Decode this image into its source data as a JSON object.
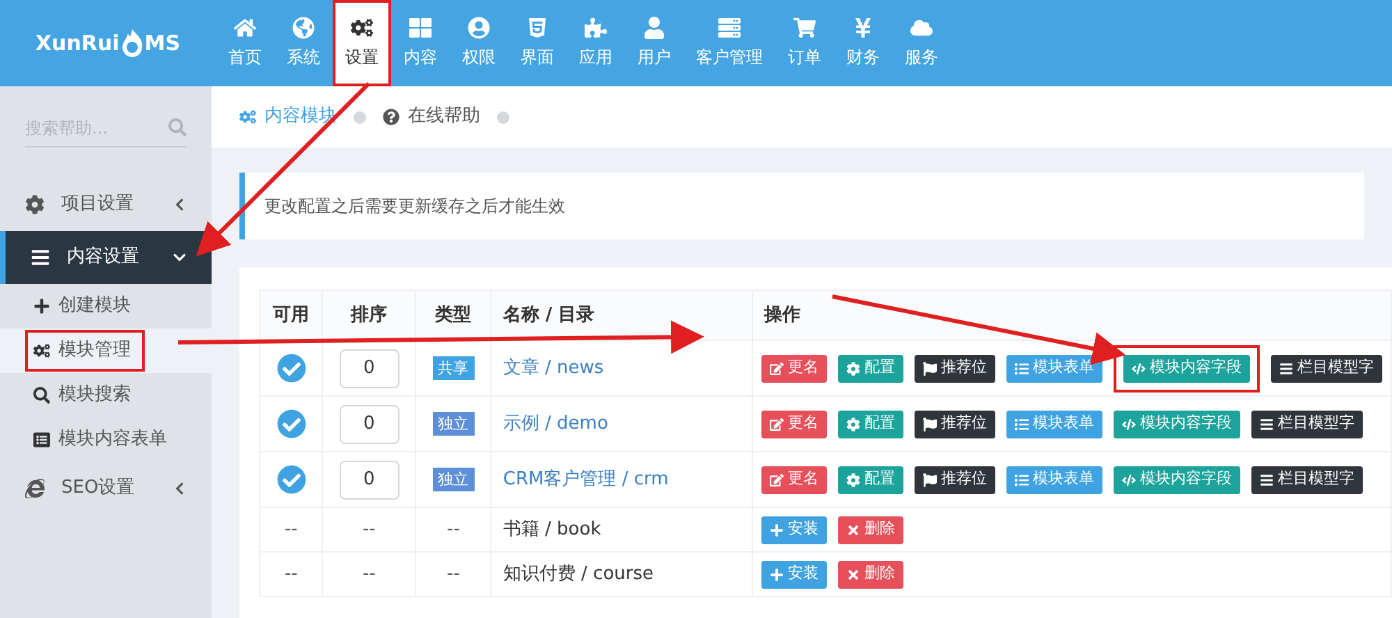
{
  "logo": {
    "text": "XunRui",
    "text_end": "MS"
  },
  "nav": [
    {
      "label": "首页",
      "selected": false,
      "highlighted": false
    },
    {
      "label": "系统",
      "selected": false,
      "highlighted": false
    },
    {
      "label": "设置",
      "selected": true,
      "highlighted": true
    },
    {
      "label": "内容",
      "selected": false,
      "highlighted": false
    },
    {
      "label": "权限",
      "selected": false,
      "highlighted": false
    },
    {
      "label": "界面",
      "selected": false,
      "highlighted": false
    },
    {
      "label": "应用",
      "selected": false,
      "highlighted": false
    },
    {
      "label": "用户",
      "selected": false,
      "highlighted": false
    },
    {
      "label": "客户管理",
      "selected": false,
      "highlighted": false
    },
    {
      "label": "订单",
      "selected": false,
      "highlighted": false
    },
    {
      "label": "财务",
      "selected": false,
      "highlighted": false
    },
    {
      "label": "服务",
      "selected": false,
      "highlighted": false
    }
  ],
  "sidebar": {
    "search": {
      "placeholder": "搜索帮助..."
    },
    "items": [
      {
        "label": "项目设置",
        "expanded": false,
        "selected": false
      },
      {
        "label": "内容设置",
        "expanded": true,
        "selected": true,
        "children": [
          {
            "label": "创建模块",
            "selected": false,
            "highlighted": false
          },
          {
            "label": "模块管理",
            "selected": true,
            "highlighted": true
          },
          {
            "label": "模块搜索",
            "selected": false,
            "highlighted": false
          },
          {
            "label": "模块内容表单",
            "selected": false,
            "highlighted": false
          }
        ]
      },
      {
        "label": "SEO设置",
        "expanded": false,
        "selected": false
      }
    ]
  },
  "breadcrumb": [
    {
      "label": "内容模块",
      "selected": true
    },
    {
      "label": "在线帮助",
      "selected": false
    }
  ],
  "notice": "更改配置之后需要更新缓存之后才能生效",
  "table": {
    "columns": [
      "可用",
      "排序",
      "类型",
      "名称 / 目录",
      "操作"
    ],
    "rows": [
      {
        "enabled": true,
        "order": "0",
        "type": {
          "label": "共享",
          "kind": "shared"
        },
        "name": "文章 / news",
        "actions": [
          {
            "label": "更名",
            "kind": "rename",
            "highlighted": false
          },
          {
            "label": "配置",
            "kind": "config",
            "highlighted": false
          },
          {
            "label": "推荐位",
            "kind": "flag",
            "highlighted": false
          },
          {
            "label": "模块表单",
            "kind": "form",
            "highlighted": false
          },
          {
            "label": "模块内容字段",
            "kind": "code",
            "highlighted": true
          },
          {
            "label": "栏目模型字",
            "kind": "model",
            "highlighted": false
          }
        ]
      },
      {
        "enabled": true,
        "order": "0",
        "type": {
          "label": "独立",
          "kind": "own"
        },
        "name": "示例 / demo",
        "actions": [
          {
            "label": "更名",
            "kind": "rename",
            "highlighted": false
          },
          {
            "label": "配置",
            "kind": "config",
            "highlighted": false
          },
          {
            "label": "推荐位",
            "kind": "flag",
            "highlighted": false
          },
          {
            "label": "模块表单",
            "kind": "form",
            "highlighted": false
          },
          {
            "label": "模块内容字段",
            "kind": "code",
            "highlighted": false
          },
          {
            "label": "栏目模型字",
            "kind": "model",
            "highlighted": false
          }
        ]
      },
      {
        "enabled": true,
        "order": "0",
        "type": {
          "label": "独立",
          "kind": "own"
        },
        "name": "CRM客户管理 / crm",
        "actions": [
          {
            "label": "更名",
            "kind": "rename",
            "highlighted": false
          },
          {
            "label": "配置",
            "kind": "config",
            "highlighted": false
          },
          {
            "label": "推荐位",
            "kind": "flag",
            "highlighted": false
          },
          {
            "label": "模块表单",
            "kind": "form",
            "highlighted": false
          },
          {
            "label": "模块内容字段",
            "kind": "code",
            "highlighted": false
          },
          {
            "label": "栏目模型字",
            "kind": "model",
            "highlighted": false
          }
        ]
      },
      {
        "enabled": false,
        "order": "--",
        "type": {
          "label": "--",
          "kind": "none"
        },
        "dash": "--",
        "name": "书籍 / book",
        "actions": [
          {
            "label": "安装",
            "kind": "install",
            "highlighted": false
          },
          {
            "label": "删除",
            "kind": "delete",
            "highlighted": false
          }
        ]
      },
      {
        "enabled": false,
        "order": "--",
        "type": {
          "label": "--",
          "kind": "none"
        },
        "dash": "--",
        "name": "知识付费 / course",
        "actions": [
          {
            "label": "安装",
            "kind": "install",
            "highlighted": false
          },
          {
            "label": "删除",
            "kind": "delete",
            "highlighted": false
          }
        ]
      }
    ]
  }
}
